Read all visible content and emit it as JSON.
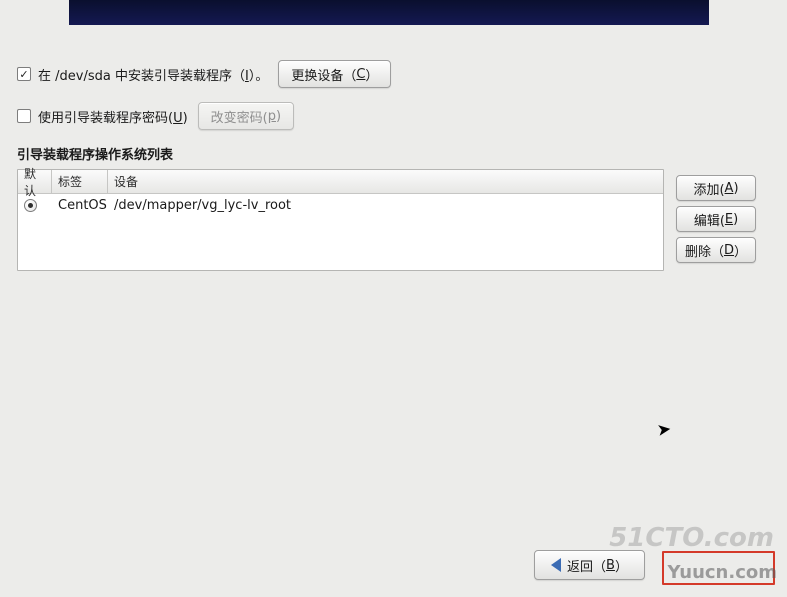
{
  "install_boot": {
    "checked": true,
    "label_pre": "在 /dev/sda 中安装引导装载程序（",
    "mnemonic": "I",
    "label_post": "）。"
  },
  "change_device_btn": {
    "label_pre": "更换设备（",
    "mnemonic": "C",
    "label_post": "）"
  },
  "use_password": {
    "checked": false,
    "label_pre": "使用引导装载程序密码(",
    "mnemonic": "U",
    "label_post": ")"
  },
  "change_pw_btn": {
    "label_pre": "改变密码(",
    "mnemonic": "p",
    "label_post": ")"
  },
  "section_title": "引导装载程序操作系统列表",
  "columns": {
    "default": "默认",
    "label": "标签",
    "device": "设备"
  },
  "rows": [
    {
      "default": true,
      "label": "CentOS",
      "device": "/dev/mapper/vg_lyc-lv_root"
    }
  ],
  "side": {
    "add": {
      "pre": "添加(",
      "m": "A",
      "post": ")"
    },
    "edit": {
      "pre": "编辑(",
      "m": "E",
      "post": ")"
    },
    "delete": {
      "pre": "删除（",
      "m": "D",
      "post": "）"
    }
  },
  "back_btn": {
    "pre": "返回（",
    "m": "B",
    "post": "）"
  },
  "watermarks": {
    "w1": "51CTO.com",
    "w2": "Yuucn.com"
  }
}
